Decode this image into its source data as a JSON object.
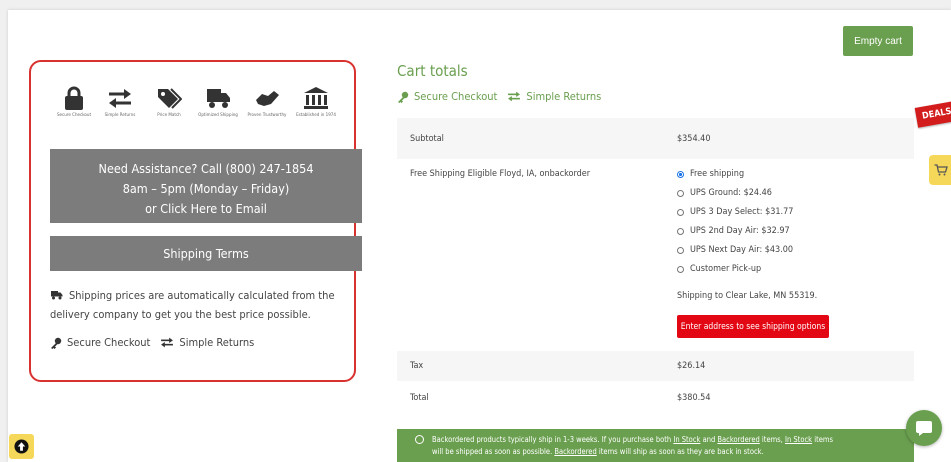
{
  "header": {
    "empty_cart_label": "Empty cart"
  },
  "features": [
    {
      "icon": "lock-icon",
      "label": "Secure Checkout"
    },
    {
      "icon": "arrows-icon",
      "label": "Simple Returns"
    },
    {
      "icon": "price-tag-icon",
      "label": "Price Match"
    },
    {
      "icon": "truck-icon",
      "label": "Optimized Shipping"
    },
    {
      "icon": "handshake-icon",
      "label": "Proven Trustworthy"
    },
    {
      "icon": "bank-icon",
      "label": "Established in 1974"
    }
  ],
  "assistance": {
    "line1": "Need Assistance? Call (800) 247-1854",
    "line2": "8am – 5pm (Monday – Friday)",
    "line3": "or Click Here to Email"
  },
  "shipping_terms_label": "Shipping Terms",
  "shipping_note": "Shipping prices are automatically calculated from the delivery company to get you the best price possible.",
  "secure_checkout_label": "Secure Checkout",
  "simple_returns_label": "Simple Returns",
  "cart_totals": {
    "title": "Cart totals",
    "subtotal_label": "Subtotal",
    "subtotal_value": "$354.40",
    "shipping_label": "Free Shipping Eligible Floyd, IA, onbackorder",
    "shipping_options": [
      {
        "label": "Free shipping",
        "selected": true
      },
      {
        "label": "UPS Ground: $24.46",
        "selected": false
      },
      {
        "label": "UPS 3 Day Select: $31.77",
        "selected": false
      },
      {
        "label": "UPS 2nd Day Air: $32.97",
        "selected": false
      },
      {
        "label": "UPS Next Day Air: $43.00",
        "selected": false
      },
      {
        "label": "Customer Pick-up",
        "selected": false
      }
    ],
    "shipping_destination": "Shipping to Clear Lake, MN 55319.",
    "enter_address_label": "Enter address to see shipping options",
    "tax_label": "Tax",
    "tax_value": "$26.14",
    "total_label": "Total",
    "total_value": "$380.54"
  },
  "notice": {
    "part1": "Backordered products typically ship in 1-3 weeks. If you purchase both ",
    "in_stock": "In Stock",
    "and": " and ",
    "backordered": "Backordered",
    "part2": " items, ",
    "in_stock2": "In Stock",
    "part3": " items",
    "part4": "will be shipped as soon as possible. ",
    "backordered2": "Backordered",
    "part5": " items will ship as soon as they are back in stock."
  },
  "deals_label": "DEALS",
  "colors": {
    "accent_green": "#6a9f4f",
    "frame_red": "#d9312f",
    "button_gray": "#7c7c7c",
    "alert_red": "#e30613",
    "highlight_yellow": "#f5d85a"
  }
}
